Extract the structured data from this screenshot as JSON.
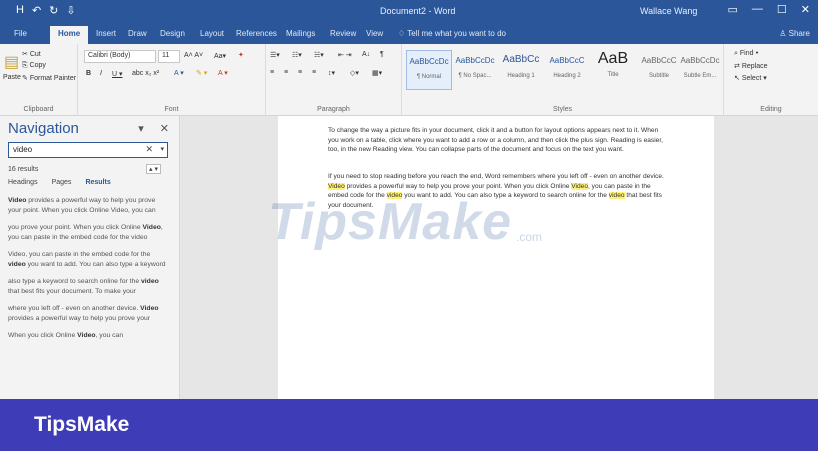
{
  "window": {
    "title": "Document2 - Word",
    "user": "Wallace Wang",
    "qat": [
      "H",
      "↶",
      "↻",
      "⇩"
    ],
    "controls": [
      "▭",
      "—",
      "☐",
      "✕"
    ]
  },
  "tabs": {
    "items": [
      "File",
      "Home",
      "Insert",
      "Draw",
      "Design",
      "Layout",
      "References",
      "Mailings",
      "Review",
      "View"
    ],
    "tell_me": "Tell me what you want to do",
    "share": "Share"
  },
  "ribbon": {
    "clipboard": {
      "paste": "Paste",
      "cut": "Cut",
      "copy": "Copy",
      "format_painter": "Format Painter",
      "label": "Clipboard"
    },
    "font": {
      "name": "Calibri (Body)",
      "size": "11",
      "label": "Font"
    },
    "paragraph": {
      "label": "Paragraph"
    },
    "styles": {
      "label": "Styles",
      "items": [
        {
          "preview": "AaBbCcDc",
          "name": "¶ Normal"
        },
        {
          "preview": "AaBbCcDc",
          "name": "¶ No Spac..."
        },
        {
          "preview": "AaBbCc",
          "name": "Heading 1"
        },
        {
          "preview": "AaBbCcC",
          "name": "Heading 2"
        },
        {
          "preview": "AaB",
          "name": "Title"
        },
        {
          "preview": "AaBbCcC",
          "name": "Subtitle"
        },
        {
          "preview": "AaBbCcDc",
          "name": "Subtle Em..."
        }
      ]
    },
    "editing": {
      "find": "Find",
      "replace": "Replace",
      "select": "Select",
      "label": "Editing"
    }
  },
  "navigation": {
    "title": "Navigation",
    "search_value": "video",
    "result_count": "16 results",
    "tabs": [
      "Headings",
      "Pages",
      "Results"
    ],
    "results": [
      {
        "pre": "",
        "bold": "Video",
        "post": " provides a powerful way to help you prove your point. When you click Online Video, you can"
      },
      {
        "pre": "you prove your point. When you click Online ",
        "bold": "Video",
        "post": ", you can paste in the embed code for the video"
      },
      {
        "pre": "Video, you can paste in the embed code for the ",
        "bold": "video",
        "post": " you want to add. You can also type a keyword"
      },
      {
        "pre": "also type a keyword to search online for the ",
        "bold": "video",
        "post": " that best fits your document. To make your"
      },
      {
        "pre": "where you left off - even on another device. ",
        "bold": "Video",
        "post": " provides a powerful way to help you prove your"
      },
      {
        "pre": "When you click Online ",
        "bold": "Video",
        "post": ", you can"
      }
    ]
  },
  "document": {
    "para1": "To change the way a picture fits in your document, click it and a button for layout options appears next to it. When you work on a table, click where you want to add a row or a column, and then click the plus sign. Reading is easier, too, in the new Reading view. You can collapse parts of the document and focus on the text you want.",
    "para2_a": "If you need to stop reading before you reach the end, Word remembers where you left off - even on another device. ",
    "para2_hl1": "Video",
    "para2_b": " provides a powerful way to help you prove your point. When you click Online ",
    "para2_hl2": "Video",
    "para2_c": ", you can paste in the embed code for the ",
    "para2_hl3": "video",
    "para2_d": " you want to add. You can also type a keyword to search online for the ",
    "para2_hl4": "video",
    "para2_e": " that best fits your document."
  },
  "watermark": {
    "main": "TipsMake",
    "sub": ".com"
  },
  "banner": {
    "brand": "TipsMake"
  },
  "colors": {
    "word_blue": "#2b579a",
    "banner": "#3f3cb7",
    "highlight": "#fff176"
  }
}
